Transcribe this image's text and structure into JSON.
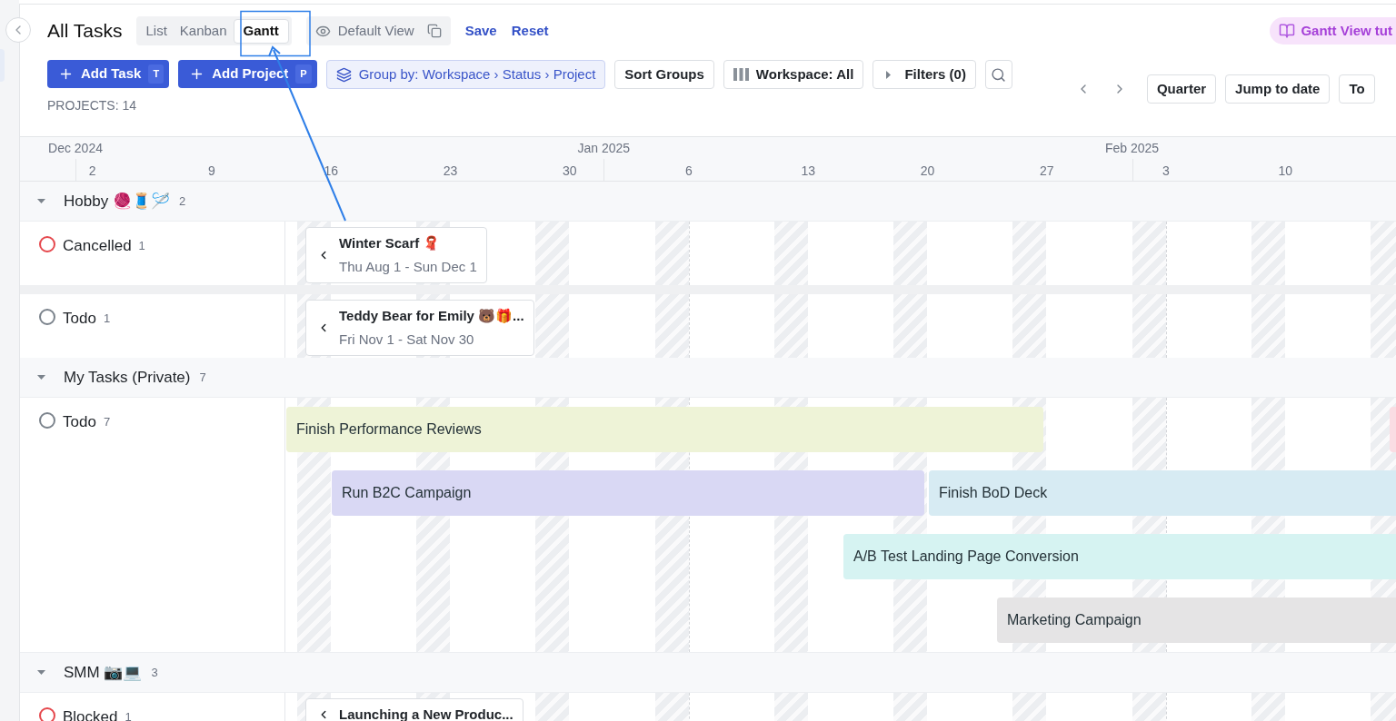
{
  "header": {
    "title": "All Tasks",
    "views": [
      {
        "label": "List",
        "selected": false
      },
      {
        "label": "Kanban",
        "selected": false
      },
      {
        "label": "Gantt",
        "selected": true
      }
    ],
    "saved_view": "Default View",
    "actions": [
      "Save",
      "Reset"
    ],
    "tutorial": "Gantt View tut"
  },
  "toolbar": {
    "add_buttons": [
      {
        "label": "Add Task",
        "shortcut": "T"
      },
      {
        "label": "Add Project",
        "shortcut": "P"
      }
    ],
    "group_by": "Group by: Workspace › Status › Project",
    "sort": "Sort Groups",
    "workspace": "Workspace: All",
    "filters": "Filters (0)",
    "scale": "Quarter",
    "jump": "Jump to date",
    "extra": "To"
  },
  "projects_count": "PROJECTS: 14",
  "timeline": {
    "months": [
      "Dec 2024",
      "Jan 2025",
      "Feb 2025"
    ],
    "days": [
      "2",
      "9",
      "16",
      "23",
      "30",
      "6",
      "13",
      "20",
      "27",
      "3",
      "10"
    ]
  },
  "groups": [
    {
      "name": "Hobby 🧶🧵🪡",
      "count": "2",
      "expanded": true,
      "statuses": [
        {
          "label": "Cancelled",
          "count": "1",
          "color": "#e5484d",
          "tasks": [
            {
              "title": "Winter Scarf 🧣",
              "dates": "Thu Aug 1 - Sun Dec 1"
            }
          ]
        },
        {
          "label": "Todo",
          "count": "1",
          "color": "#7b838c",
          "tasks": [
            {
              "title": "Teddy Bear for Emily 🐻🎁...",
              "dates": "Fri Nov 1 - Sat Nov 30"
            }
          ]
        }
      ]
    },
    {
      "name": "My Tasks (Private)",
      "count": "7",
      "expanded": true,
      "statuses": [
        {
          "label": "Todo",
          "count": "7",
          "color": "#7b838c",
          "bars": [
            {
              "label": "Finish Performance Reviews",
              "color": "#eef3d7"
            },
            {
              "color": "#fadde3"
            },
            {
              "label": "Run B2C Campaign",
              "color": "#d9d8f4"
            },
            {
              "label": "Finish BoD Deck",
              "color": "#d7ebf3"
            },
            {
              "label": "A/B Test Landing Page Conversion",
              "color": "#d6f3f2"
            },
            {
              "label": "Marketing Campaign",
              "color": "#e5e4e5"
            }
          ]
        }
      ]
    },
    {
      "name": "SMM 📷💻",
      "count": "3",
      "expanded": true,
      "statuses": [
        {
          "label": "Blocked",
          "count": "1",
          "color": "#e5484d",
          "tasks": [
            {
              "title": "Launching a New Produc..."
            }
          ]
        }
      ]
    }
  ]
}
